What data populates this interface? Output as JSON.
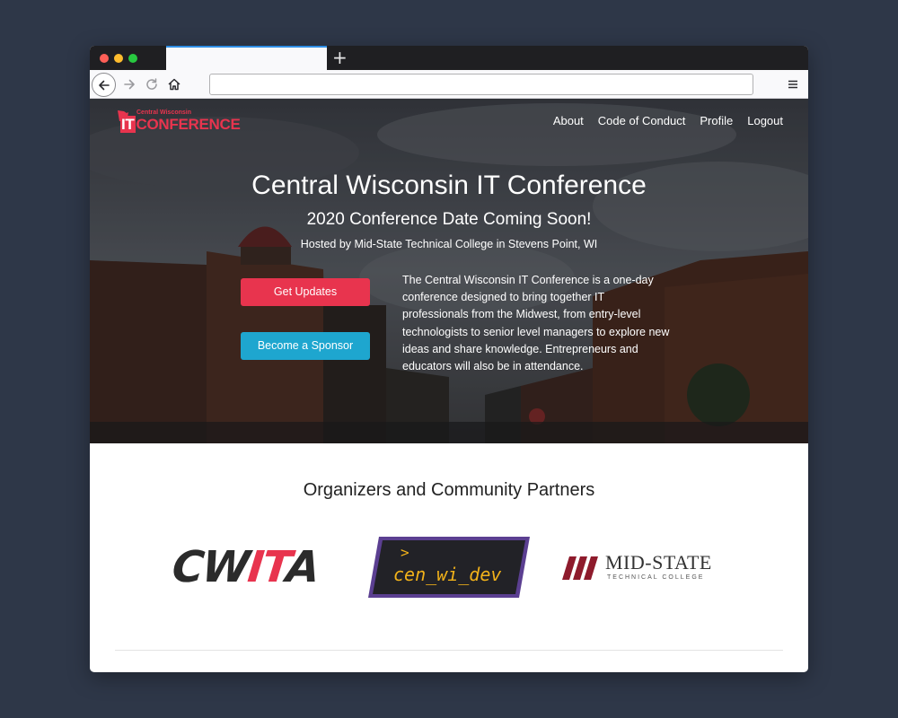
{
  "browser": {
    "new_tab_symbol": "+",
    "url": "",
    "icons": {
      "back": "back-arrow-icon",
      "forward": "forward-arrow-icon",
      "reload": "reload-icon",
      "home": "home-icon",
      "menu": "hamburger-menu-icon"
    }
  },
  "site": {
    "logo": {
      "small": "Central Wisconsin",
      "big": "CONFERENCE",
      "prefix": "IT"
    },
    "nav": [
      "About",
      "Code of Conduct",
      "Profile",
      "Logout"
    ]
  },
  "hero": {
    "title": "Central Wisconsin IT Conference",
    "subtitle": "2020 Conference Date Coming Soon!",
    "hosted": "Hosted by Mid-State Technical College in Stevens Point, WI",
    "buttons": {
      "updates": "Get Updates",
      "sponsor": "Become a Sponsor"
    },
    "description": "The Central Wisconsin IT Conference is a one-day conference designed to bring together IT professionals from the Midwest, from entry-level technologists to senior level managers to explore new ideas and share knowledge. Entrepreneurs and educators will also be in attendance."
  },
  "partners": {
    "title": "Organizers and Community Partners",
    "logos": {
      "cwita": {
        "left": "CW",
        "mid": "IT",
        "right": "A"
      },
      "cenwidev": {
        "prompt": ">",
        "text": "cen_wi_dev"
      },
      "midstate": {
        "name": "MID-STATE",
        "tagline": "TECHNICAL COLLEGE"
      }
    }
  },
  "colors": {
    "accent_red": "#e8344e",
    "accent_blue": "#1ea6cf",
    "cenwidev_border": "#5b3f91",
    "cenwidev_text": "#f2b21a",
    "midstate_red": "#8e1b2c"
  }
}
